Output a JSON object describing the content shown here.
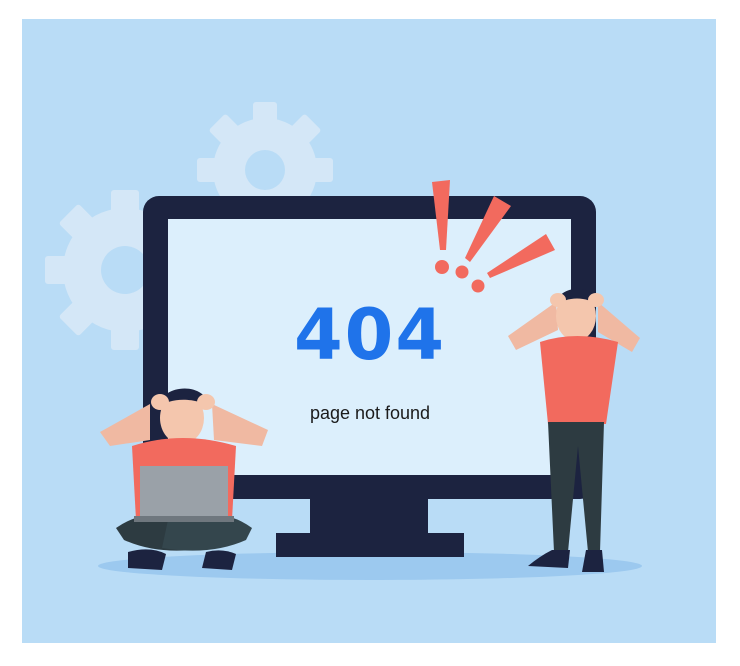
{
  "error": {
    "code": "404",
    "message": "page not found"
  },
  "colors": {
    "background": "#b9dcf6",
    "screen": "#dceffc",
    "monitor_frame": "#1c2340",
    "accent_blue": "#1f73ea",
    "alert_red": "#f26a5e",
    "gear": "#d4e7f7"
  },
  "icons": [
    "gear-icon",
    "exclamation-icon",
    "laptop-icon"
  ]
}
